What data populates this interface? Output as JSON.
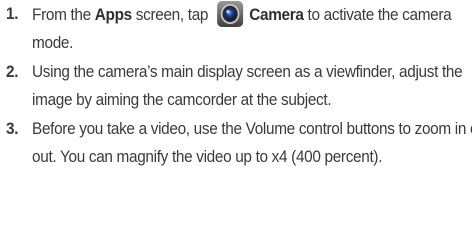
{
  "steps": [
    {
      "number": "1.",
      "parts": {
        "t1": "From the ",
        "b1": "Apps",
        "t2": " screen, tap ",
        "b2": "Camera",
        "t3": " to activate the camera mode."
      },
      "icon": "camera-app-icon"
    },
    {
      "number": "2.",
      "text": "Using the camera’s main display screen as a viewfinder, adjust the image by aiming the camcorder at the subject."
    },
    {
      "number": "3.",
      "text": "Before you take a video, use the Volume control buttons to zoom in or out. You can magnify the video up to x4 (400 percent)."
    }
  ],
  "colors": {
    "text": "#3a3a3a",
    "icon_ring": "#7a7a7a",
    "icon_lens": "#1d3f8f"
  }
}
